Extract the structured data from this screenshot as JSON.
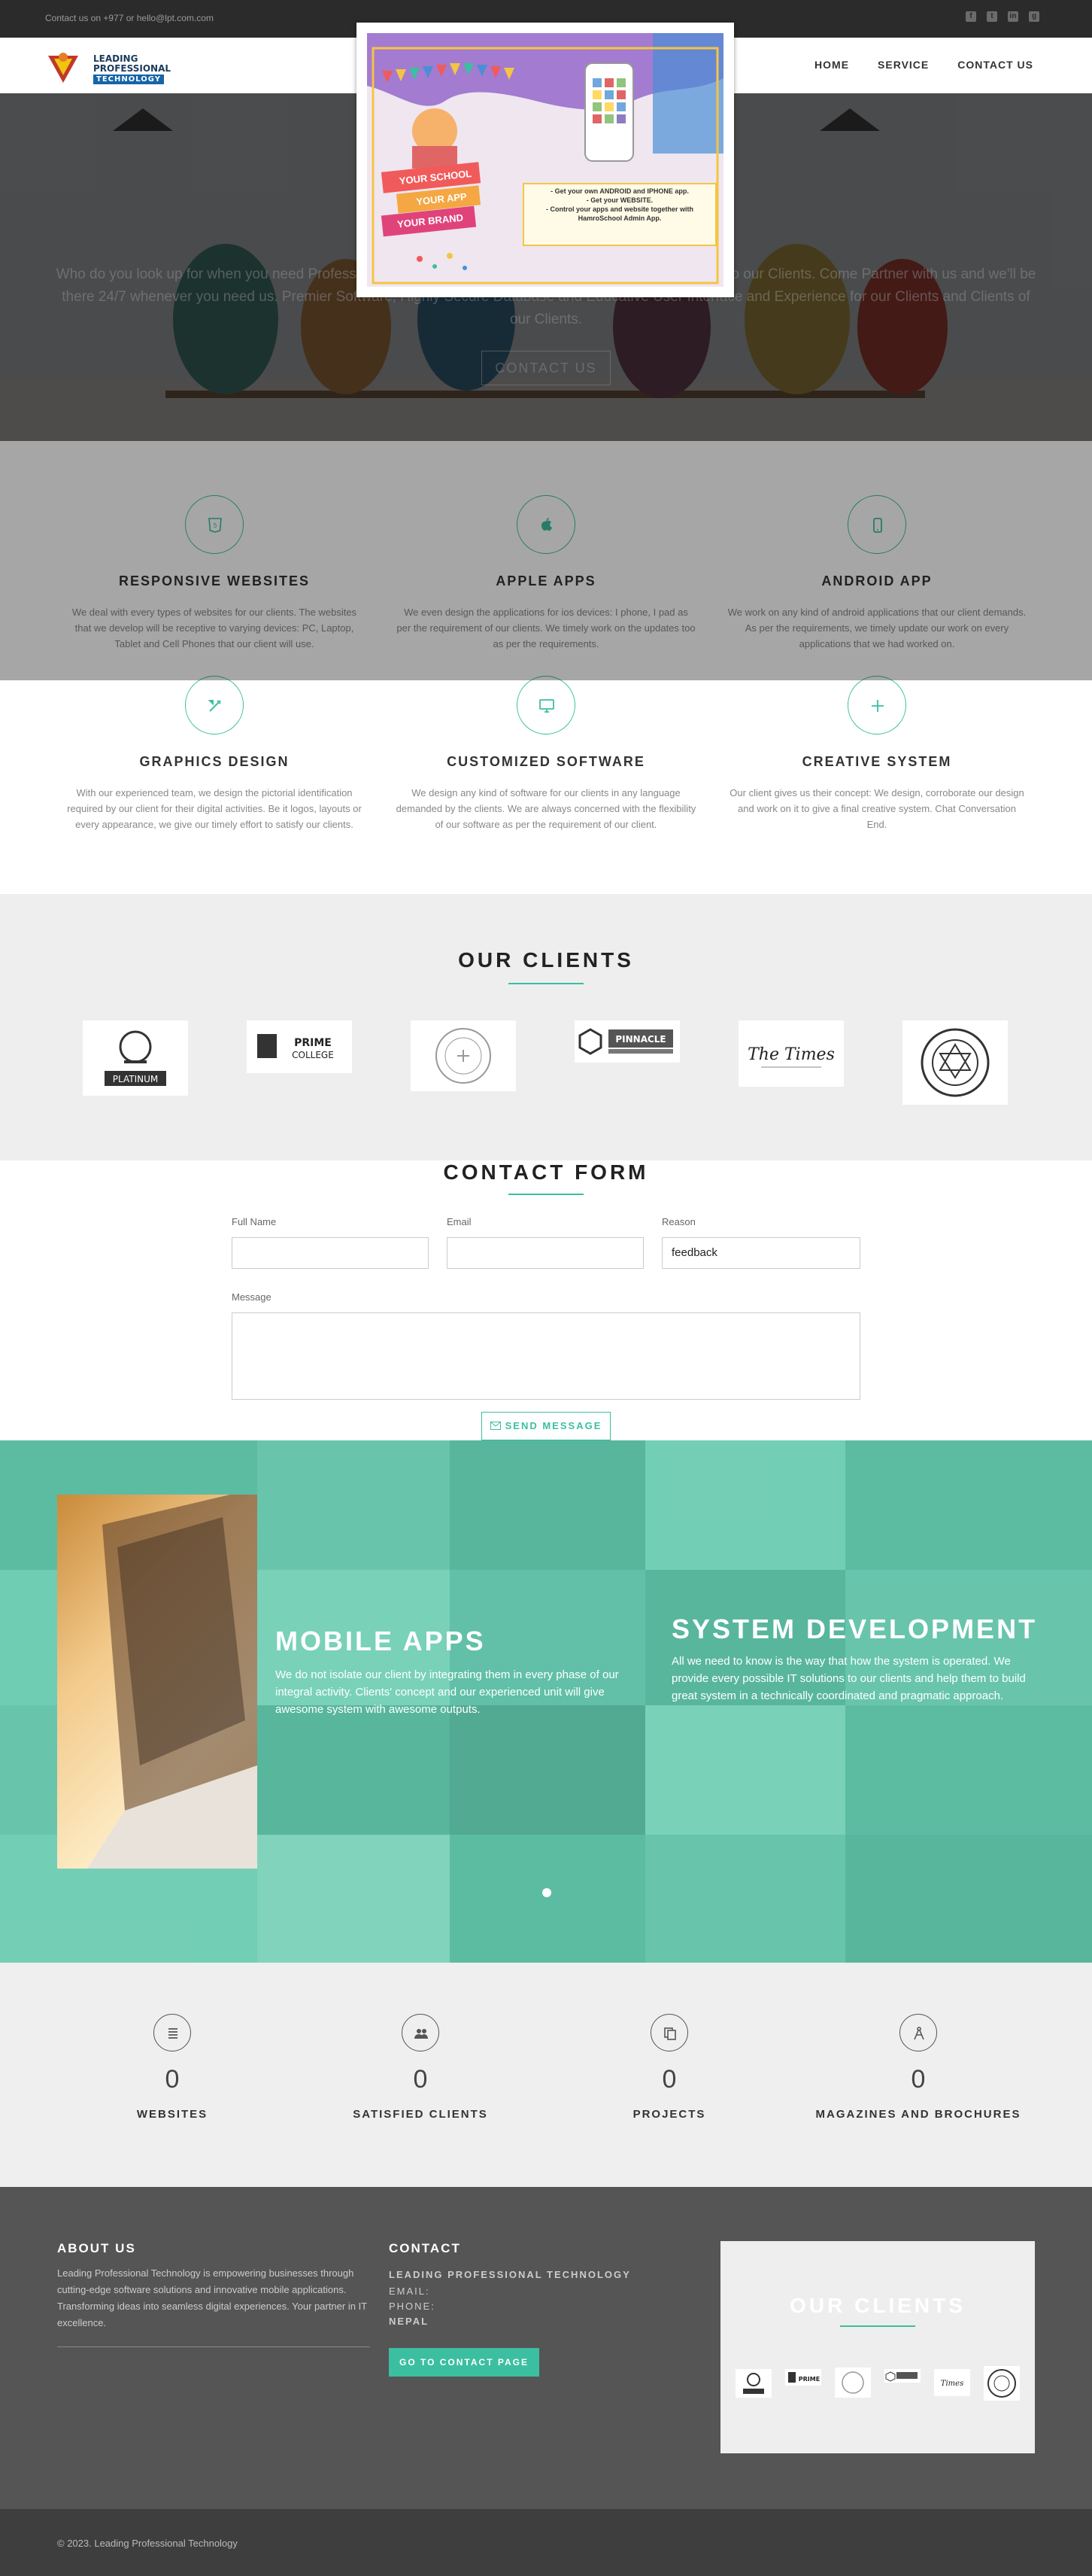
{
  "topbar": {
    "contact": "Contact us on +977 or hello@lpt.com.com",
    "social": [
      "f",
      "t",
      "in",
      "g"
    ]
  },
  "brand": {
    "line1": "LEADING",
    "line2": "PROFESSIONAL",
    "line3": "TECHNOLOGY"
  },
  "nav": {
    "items": [
      "HOME",
      "SERVICE",
      "CONTACT US"
    ]
  },
  "hero": {
    "text": "Who do you look up for when you need Professional IT Services? We provide professional IT consultation to our Clients. Come Partner with us and we'll be there 24/7 whenever you need us. Premier Software, Highly Secure Database and Educative User Interface and Experience for our Clients and Clients of our Clients.",
    "button": "CONTACT US"
  },
  "modal": {
    "badge1": "YOUR SCHOOL",
    "badge2": "YOUR APP",
    "badge3": "YOUR BRAND",
    "bullet1": "- Get your own ANDROID and IPHONE app.",
    "bullet2": "- Get your WEBSITE.",
    "bullet3": "- Control your apps and website together with HamroSchool Admin App."
  },
  "services": [
    {
      "title": "RESPONSIVE WEBSITES",
      "icon": "html5-icon",
      "text": "We deal with every types of websites for our clients. The websites that we develop will be receptive to varying devices: PC, Laptop, Tablet and Cell Phones that our client will use."
    },
    {
      "title": "APPLE APPS",
      "icon": "apple-icon",
      "text": "We even design the applications for ios devices: I phone, I pad as per the requirement of our clients. We timely work on the updates too as per the requirements."
    },
    {
      "title": "ANDROID APP",
      "icon": "mobile-icon",
      "text": "We work on any kind of android applications that our client demands. As per the requirements, we timely update our work on every applications that we had worked on."
    },
    {
      "title": "GRAPHICS DESIGN",
      "icon": "design-tools-icon",
      "text": "With our experienced team, we design the pictorial identification required by our client for their digital activities. Be it logos, layouts or every appearance, we give our timely effort to satisfy our clients."
    },
    {
      "title": "CUSTOMIZED SOFTWARE",
      "icon": "desktop-icon",
      "text": "We design any kind of software for our clients in any language demanded by the clients. We are always concerned with the flexibility of our software as per the requirement of our client."
    },
    {
      "title": "CREATIVE SYSTEM",
      "icon": "plus-icon",
      "text": "Our client gives us their concept: We design, corroborate our design and work on it to give a final creative system. Chat Conversation End."
    }
  ],
  "clients": {
    "title": "OUR CLIENTS",
    "logos": [
      {
        "name": "platinum-logo",
        "label": "PLATINUM"
      },
      {
        "name": "prime-college-logo",
        "label": "PRIME COLLEGE"
      },
      {
        "name": "seal-logo-1",
        "label": ""
      },
      {
        "name": "pinnacle-logo",
        "label": "PINNACLE"
      },
      {
        "name": "the-times-logo",
        "label": "The Times"
      },
      {
        "name": "seal-logo-2",
        "label": ""
      }
    ]
  },
  "contact": {
    "title": "CONTACT FORM",
    "fullname_label": "Full Name",
    "email_label": "Email",
    "reason_label": "Reason",
    "reason_value": "feedback",
    "message_label": "Message",
    "send": "SEND MESSAGE"
  },
  "slider": {
    "left_title": "MOBILE APPS",
    "left_text": "We do not isolate our client by integrating them in every phase of our integral activity. Clients' concept and our experienced unit will give awesome system with awesome outputs.",
    "right_title": "SYSTEM DEVELOPMENT",
    "right_text": "All we need to know is the way that how the system is operated. We provide every possible IT solutions to our clients and help them to build great system in a technically coordinated and pragmatic approach."
  },
  "counters": [
    {
      "value": "0",
      "label": "WEBSITES",
      "icon": "list-icon"
    },
    {
      "value": "0",
      "label": "SATISFIED CLIENTS",
      "icon": "users-icon"
    },
    {
      "value": "0",
      "label": "PROJECTS",
      "icon": "copy-icon"
    },
    {
      "value": "0",
      "label": "MAGAZINES AND BROCHURES",
      "icon": "compass-icon"
    }
  ],
  "footer": {
    "about_title": "ABOUT US",
    "about_text": "Leading Professional Technology is empowering businesses through cutting-edge software solutions and innovative mobile applications. Transforming ideas into seamless digital experiences. Your partner in IT excellence.",
    "contact_title": "CONTACT",
    "company": "LEADING PROFESSIONAL TECHNOLOGY",
    "email": "EMAIL:",
    "phone": "PHONE:",
    "country": "NEPAL",
    "contact_button": "GO TO CONTACT PAGE",
    "clients_title": "OUR CLIENTS",
    "copyright": "© 2023. Leading Professional Technology"
  },
  "colors": {
    "accent": "#3bbfa0",
    "dark": "#2b2b2b",
    "footer": "#555555"
  }
}
